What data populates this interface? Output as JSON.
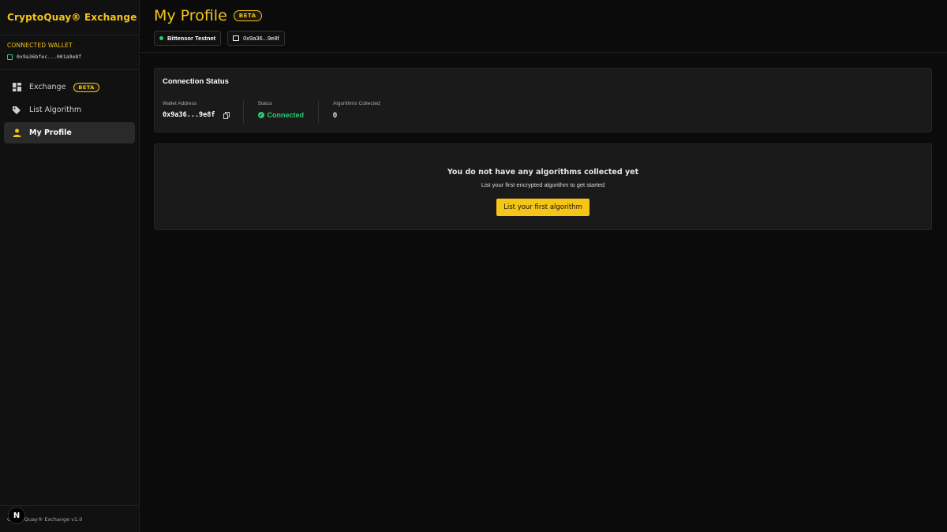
{
  "sidebar": {
    "brand": "CryptoQuay® Exchange",
    "wallet_heading": "CONNECTED WALLET",
    "wallet_address": "0x9a36bfec...001a9e8f",
    "nav": [
      {
        "label": "Exchange",
        "badge": "BETA",
        "icon": "grid-icon"
      },
      {
        "label": "List Algorithm",
        "icon": "tag-icon"
      },
      {
        "label": "My Profile",
        "icon": "user-icon",
        "active": true
      }
    ],
    "footer": "CryptoQuay® Exchange v1.0",
    "dev_badge": "N"
  },
  "header": {
    "title": "My Profile",
    "badge": "BETA",
    "network": "Bittensor Testnet",
    "wallet_short": "0x9a36...9e8f"
  },
  "connection": {
    "title": "Connection Status",
    "wallet_label": "Wallet Address",
    "wallet_value": "0x9a36...9e8f",
    "status_label": "Status",
    "status_value": "Connected",
    "algos_label": "Algorithms Collected",
    "algos_value": "0"
  },
  "empty_state": {
    "title": "You do not have any algorithms collected yet",
    "subtitle": "List your first encrypted algorithm to get started",
    "cta": "List your first algorithm"
  },
  "colors": {
    "accent": "#f5c518",
    "success": "#2ecc71",
    "background": "#0b0b0b",
    "card": "#1a1a1a"
  }
}
